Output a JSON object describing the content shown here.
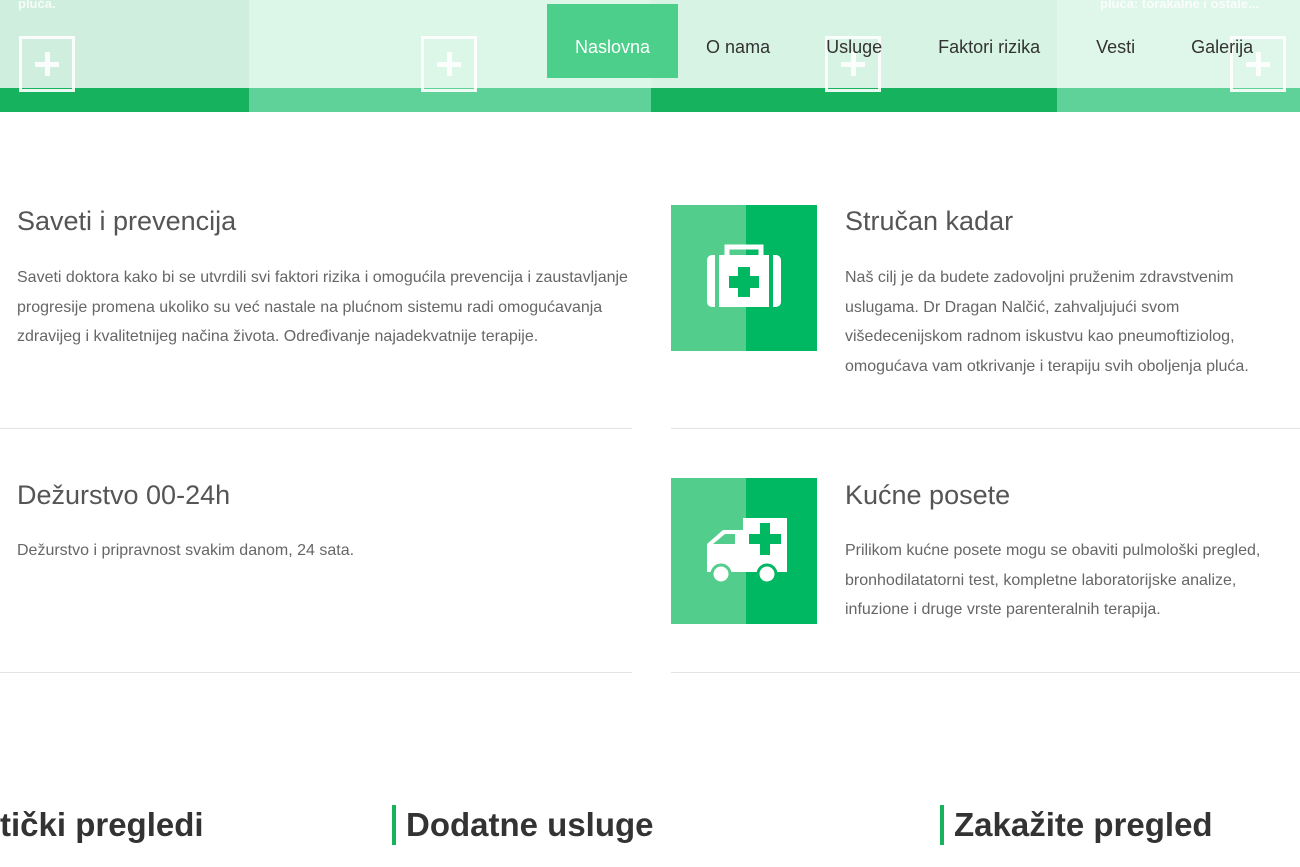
{
  "header": {
    "panel_text_left": "pluća.",
    "panel_text_right": "pluća: torakalne i ostale...",
    "colors": {
      "panel_light": "#d7f5e4",
      "bar_dark": "#17b25e",
      "bar_light": "#5fd299",
      "nav_active": "#4ccf8a"
    }
  },
  "nav": {
    "items": [
      {
        "label": "Naslovna",
        "active": true
      },
      {
        "label": "O nama",
        "active": false
      },
      {
        "label": "Usluge",
        "active": false
      },
      {
        "label": "Faktori rizika",
        "active": false
      },
      {
        "label": "Vesti",
        "active": false
      },
      {
        "label": "Galerija",
        "active": false
      }
    ]
  },
  "features": [
    {
      "title": "Saveti i prevencija",
      "text": "Saveti doktora kako bi se utvrdili svi faktori rizika i omogućila prevencija i zaustavljanje progresije promena ukoliko su već nastale na plućnom sistemu radi omogućavanja zdravijeg i kvalitetnijeg načina života. Određivanje najadekvatnije terapije."
    },
    {
      "title": "Stručan kadar",
      "icon": "first-aid-kit-icon",
      "text": "Naš cilj je da budete zadovoljni pruženim zdravstvenim uslugama. Dr Dragan Nalčić, zahvaljujući svom višedecenijskom radnom iskustvu kao pneumoftiziolog, omogućava vam otkrivanje i terapiju svih oboljenja pluća."
    },
    {
      "title": "Dežurstvo 00-24h",
      "text": "Dežurstvo i pripravnost svakim danom, 24 sata."
    },
    {
      "title": "Kućne posete",
      "icon": "ambulance-icon",
      "text": "Prilikom kućne posete mogu se obaviti pulmološki pregled, bronhodilatatorni test, kompletne laboratorijske analize, infuzione i druge vrste parenteralnih terapija."
    }
  ],
  "sections": [
    {
      "title": "tički pregledi"
    },
    {
      "title": "Dodatne usluge"
    },
    {
      "title": "Zakažite pregled"
    }
  ]
}
